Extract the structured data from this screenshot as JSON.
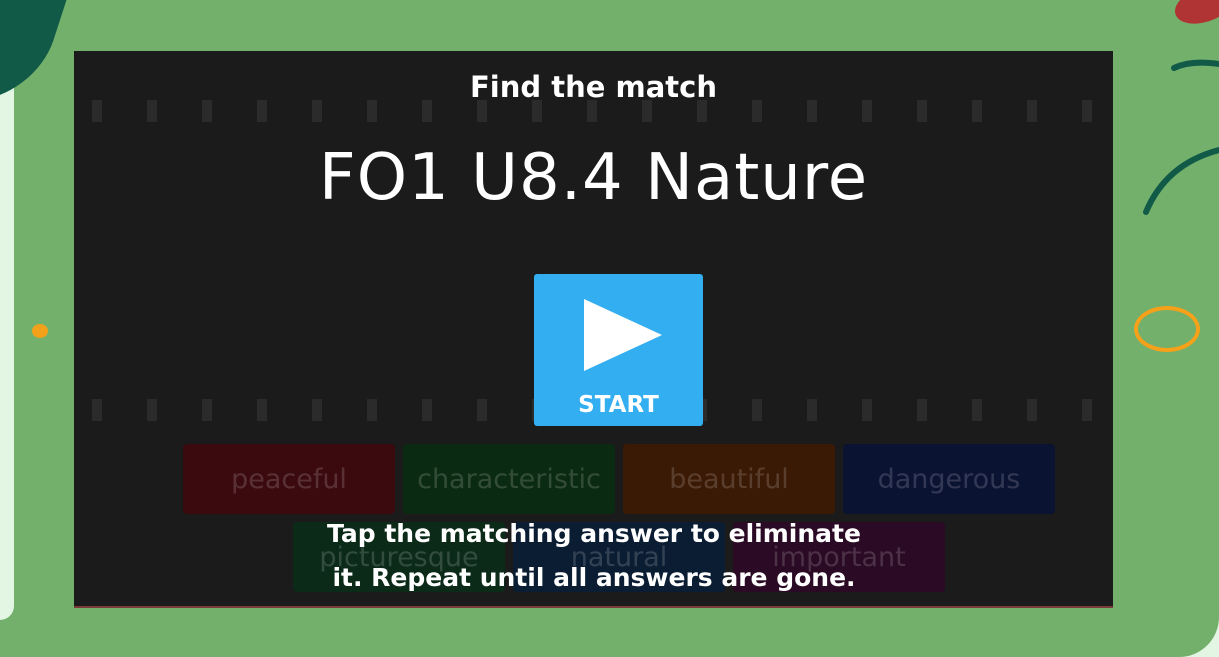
{
  "activity": {
    "template_type": "Find the match",
    "title": "FO1 U8.4 Nature",
    "start_label": "START",
    "instructions_line1": "Tap the matching answer to eliminate",
    "instructions_line2": "it. Repeat until all answers are gone."
  },
  "answer_tiles": [
    {
      "label": "peaceful",
      "color": "#3a0a0f"
    },
    {
      "label": "characteristic",
      "color": "#0b2a12"
    },
    {
      "label": "beautiful",
      "color": "#3b1a05"
    },
    {
      "label": "dangerous",
      "color": "#0b1333"
    },
    {
      "label": "picturesque",
      "color": "#0b2a18"
    },
    {
      "label": "natural",
      "color": "#0b1d33"
    },
    {
      "label": "important",
      "color": "#2a0a24"
    }
  ],
  "colors": {
    "tablet_frame": "#72b06c",
    "game_background": "#1b1b1b",
    "start_button": "#33aef0",
    "accent_orange": "#f5a11a"
  },
  "icons": {
    "start": "play-icon"
  }
}
